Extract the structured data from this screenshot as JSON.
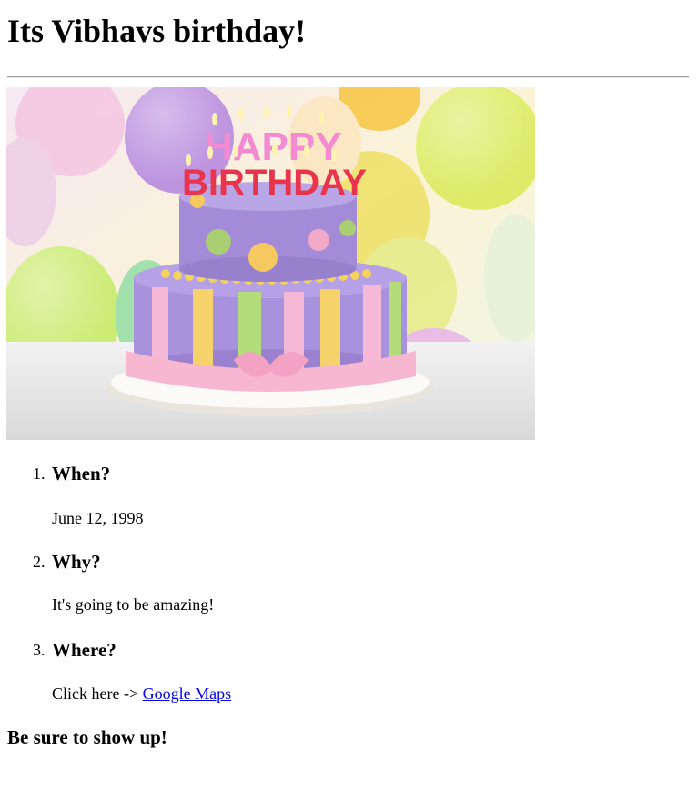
{
  "page": {
    "title": "Its Vibhavs birthday!",
    "footer": "Be sure to show up!"
  },
  "image": {
    "cake_letters_top": "HAPPY",
    "cake_letters_bottom": "BIRTHDAY"
  },
  "list": [
    {
      "number": "1.",
      "heading": "When?",
      "body": "June 12, 1998"
    },
    {
      "number": "2.",
      "heading": "Why?",
      "body": "It's going to be amazing!"
    },
    {
      "number": "3.",
      "heading": "Where?",
      "body_prefix": "Click here -> ",
      "link_text": "Google Maps"
    }
  ],
  "colors": {
    "link": "#0000ee",
    "rule": "#a0a0a0"
  }
}
